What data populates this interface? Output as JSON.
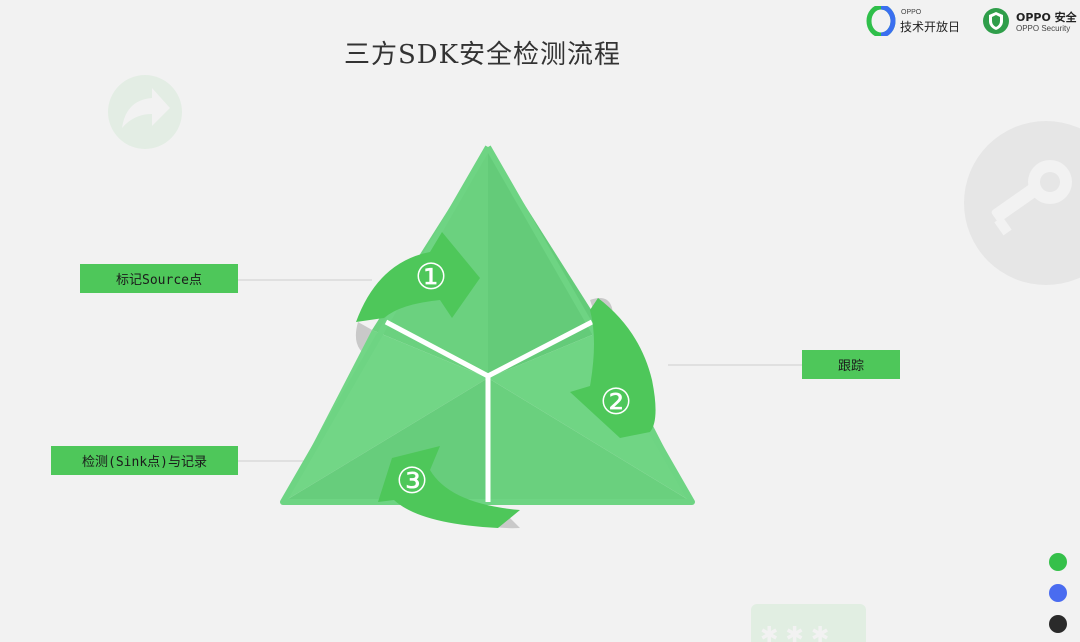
{
  "title": "三方SDK安全检测流程",
  "logos": {
    "tech_small": "OPPO",
    "tech_big": "技术开放日",
    "security_big": "OPPO 安全",
    "security_small": "OPPO Security"
  },
  "steps": [
    {
      "number": "①",
      "label": "标记Source点"
    },
    {
      "number": "②",
      "label": "跟踪"
    },
    {
      "number": "③",
      "label": "检测(Sink点)与记录"
    }
  ],
  "decor_icons": [
    "share-icon",
    "key-icon",
    "password-icon"
  ],
  "nav_dots": [
    "#35c04a",
    "#4a6cf0",
    "#2a2a2a"
  ],
  "colors": {
    "accent": "#4ec75a",
    "triangle": "#6ed483",
    "background": "#f2f2f2"
  }
}
